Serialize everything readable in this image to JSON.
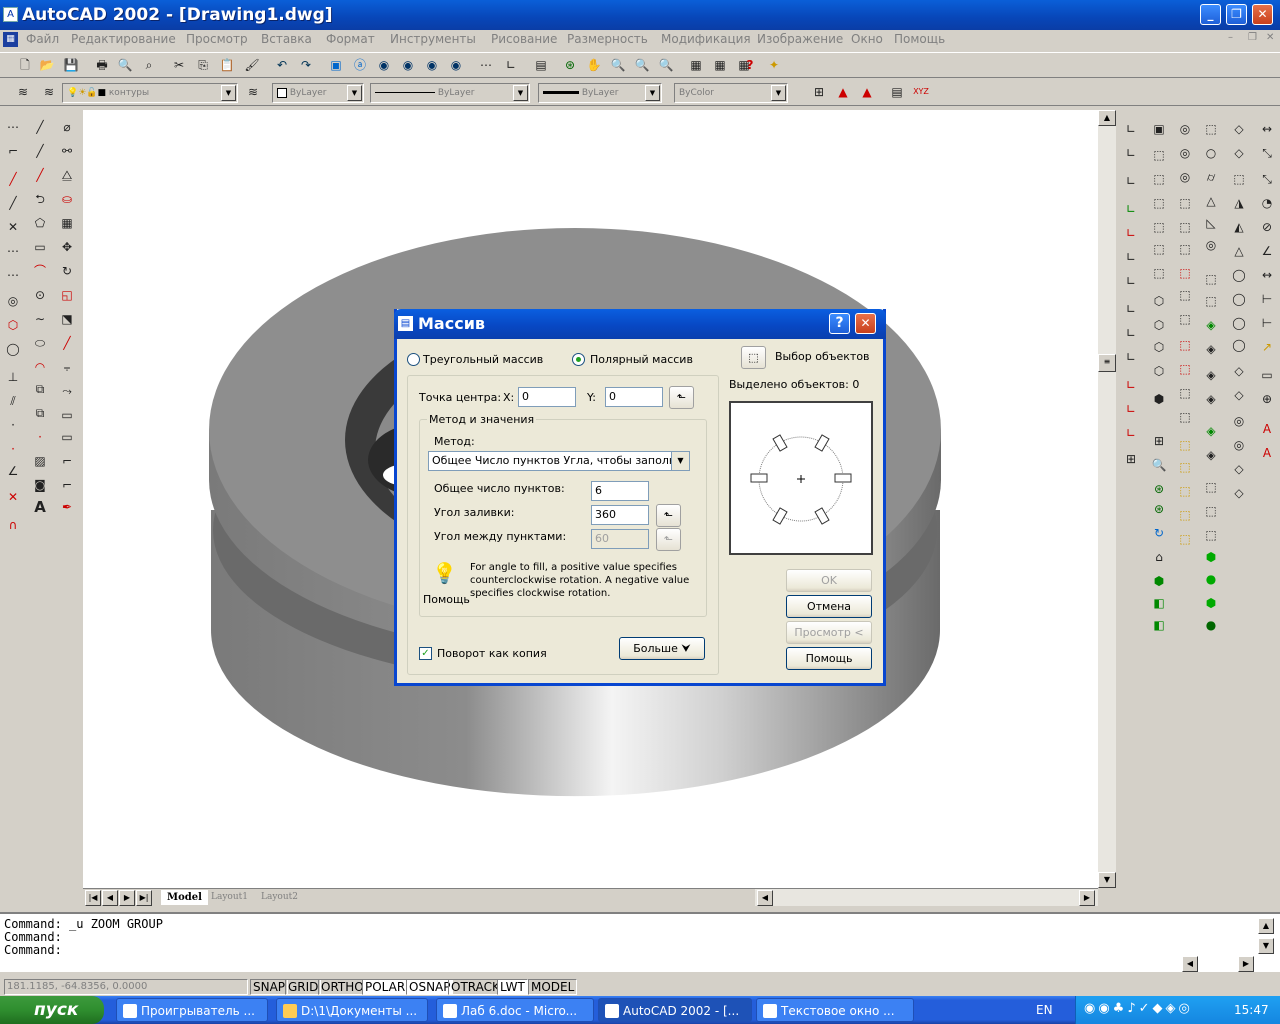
{
  "window": {
    "title": "AutoCAD 2002 - [Drawing1.dwg]"
  },
  "menu": [
    "Файл",
    "Редактирование",
    "Просмотр",
    "Вставка",
    "Формат",
    "Инструменты",
    "Рисование",
    "Размерность",
    "Модификация",
    "Изображение",
    "Окно",
    "Помощь"
  ],
  "properties": {
    "layer": "контуры",
    "color": "ByLayer",
    "linetype": "ByLayer",
    "lineweight": "ByLayer",
    "plotstyle": "ByColor"
  },
  "tabs": {
    "model": "Model",
    "layout1": "Layout1",
    "layout2": "Layout2"
  },
  "command_lines": [
    "Command:  _u ZOOM GROUP",
    "Command:",
    "Command:"
  ],
  "status": {
    "coords": "181.1185, -64.8356, 0.0000",
    "toggles": [
      "SNAP",
      "GRID",
      "ORTHO",
      "POLAR",
      "OSNAP",
      "OTRACK",
      "LWT",
      "MODEL"
    ]
  },
  "dialog": {
    "title": "Массив",
    "rect_label": "Треугольный массив",
    "polar_label": "Полярный массив",
    "select_label": "Выбор объектов",
    "selected_count": "Выделено объектов: 0",
    "center_label": "Точка центра:",
    "x_label": "X:",
    "x_value": "0",
    "y_label": "Y:",
    "y_value": "0",
    "group_label": "Метод и значения",
    "method_label": "Метод:",
    "method_value": "Общее Число пунктов Угла, чтобы заполнить",
    "total_label": "Общее число пунктов:",
    "total_value": "6",
    "fill_label": "Угол заливки:",
    "fill_value": "360",
    "between_label": "Угол между пунктами:",
    "between_value": "60",
    "hint": "For angle to fill, a positive value specifies counterclockwise rotation.  A negative value specifies clockwise rotation.",
    "help_small": "Помощь",
    "rotate_label": "Поворот как копия",
    "more_label": "Больше",
    "ok": "OK",
    "cancel": "Отмена",
    "preview": "Просмотр <",
    "help": "Помощь"
  },
  "taskbar": {
    "start": "пуск",
    "tasks": [
      "Проигрыватель ...",
      "D:\\1\\Документы ...",
      "Лаб 6.doc - Micro...",
      "AutoCAD 2002 - [...",
      "Текстовое окно ..."
    ],
    "lang": "EN",
    "time": "15:47"
  }
}
